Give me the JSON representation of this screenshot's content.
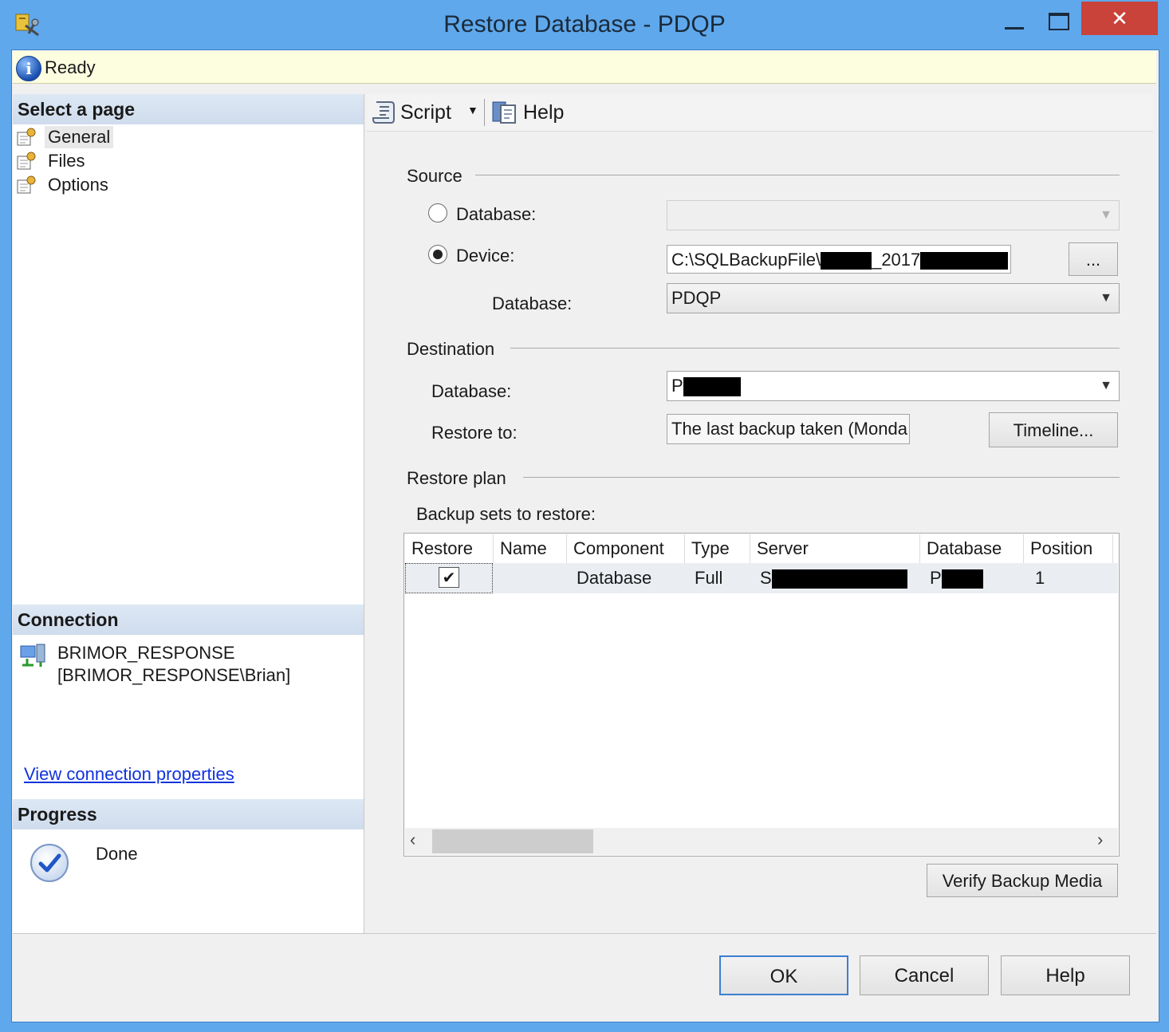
{
  "window": {
    "title": "Restore Database - PDQP",
    "close_glyph": "✕"
  },
  "status": {
    "text": "Ready"
  },
  "left": {
    "select_page_header": "Select a page",
    "pages": [
      {
        "label": "General",
        "selected": true
      },
      {
        "label": "Files",
        "selected": false
      },
      {
        "label": "Options",
        "selected": false
      }
    ],
    "connection_header": "Connection",
    "connection_name": "BRIMOR_RESPONSE",
    "connection_user": "[BRIMOR_RESPONSE\\Brian]",
    "view_connection_link": "View connection properties",
    "progress_header": "Progress",
    "progress_status": "Done"
  },
  "toolbar": {
    "script_label": "Script",
    "dropdown_glyph": "▼",
    "help_label": "Help"
  },
  "source": {
    "title": "Source",
    "database_radio_label": "Database:",
    "device_radio_label": "Device:",
    "device_path_prefix": "C:\\SQLBackupFile\\",
    "device_path_mid": "_2017",
    "browse_label": "...",
    "device_database_label": "Database:",
    "device_database_value": "PDQP"
  },
  "destination": {
    "title": "Destination",
    "database_label": "Database:",
    "database_value_prefix": "P",
    "restore_to_label": "Restore to:",
    "restore_to_value": "The last backup taken (Monda",
    "timeline_button": "Timeline..."
  },
  "restore_plan": {
    "title": "Restore plan",
    "backup_sets_label": "Backup sets to restore:",
    "columns": [
      "Restore",
      "Name",
      "Component",
      "Type",
      "Server",
      "Database",
      "Position"
    ],
    "rows": [
      {
        "restore": true,
        "name": "",
        "component": "Database",
        "type": "Full",
        "server_prefix": "S",
        "database_prefix": "P",
        "position": "1"
      }
    ],
    "verify_button": "Verify Backup Media"
  },
  "footer": {
    "ok": "OK",
    "cancel": "Cancel",
    "help": "Help"
  },
  "icons": {
    "app": "restore-app-icon",
    "info": "info-icon",
    "page": "page-gear-icon",
    "connection": "server-connection-icon",
    "done": "check-circle-icon",
    "script": "script-scroll-icon",
    "help": "help-document-icon"
  },
  "colors": {
    "titlebar": "#5fa8ec",
    "close": "#c9433a",
    "status_bg": "#fdfde0",
    "link": "#1133dd"
  }
}
